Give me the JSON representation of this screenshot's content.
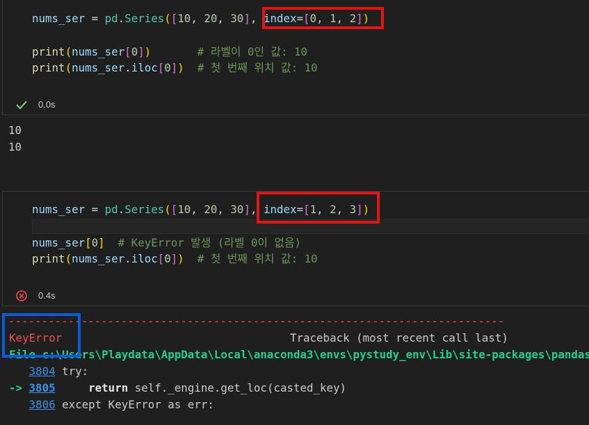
{
  "cell1": {
    "line1": {
      "v": "nums_ser",
      "eq": " = ",
      "m": "pd",
      "dot": ".",
      "cls": "Series",
      "p1": "(",
      "b2": "[",
      "n1": "10",
      "c1": ", ",
      "n2": "20",
      "c2": ", ",
      "n3": "30",
      "b2c": "]",
      "c3": ", ",
      "kw": "index",
      "eq2": "=",
      "b2o": "[",
      "i1": "0",
      "ic1": ", ",
      "i2": "1",
      "ic2": ", ",
      "i3": "2",
      "b2c2": "]",
      "p1c": ")"
    },
    "line2": {
      "f": "print",
      "p": "(",
      "v": "nums_ser",
      "b": "[",
      "n": "0",
      "bc": "]",
      "pc": ")",
      "cmt": "       # 라벨이 0인 값: 10"
    },
    "line3": {
      "f": "print",
      "p": "(",
      "v": "nums_ser",
      "dot": ".",
      "attr": "iloc",
      "b": "[",
      "n": "0",
      "bc": "]",
      "pc": ")",
      "cmt": "  # 첫 번째 위치 값: 10"
    },
    "status_time": "0.0s",
    "status_icon": "check-icon"
  },
  "output1": [
    "10",
    "10"
  ],
  "cell2": {
    "line1": {
      "v": "nums_ser",
      "eq": " = ",
      "m": "pd",
      "dot": ".",
      "cls": "Series",
      "p1": "(",
      "b2": "[",
      "n1": "10",
      "c1": ", ",
      "n2": "20",
      "c2": ", ",
      "n3": "30",
      "b2c": "]",
      "c3": ", ",
      "kw": "index",
      "eq2": "=",
      "b2o": "[",
      "i1": "1",
      "ic1": ", ",
      "i2": "2",
      "ic2": ", ",
      "i3": "3",
      "b2c2": "]",
      "p1c": ")"
    },
    "line3": {
      "v": "nums_ser",
      "b": "[",
      "n": "0",
      "bc": "]",
      "cmt": "  # KeyError 발생 (라벨 0이 없음)"
    },
    "line4": {
      "f": "print",
      "p": "(",
      "v": "nums_ser",
      "dot": ".",
      "attr": "iloc",
      "b": "[",
      "n": "0",
      "bc": "]",
      "pc": ")",
      "cmt": "  # 첫 번째 위치 값: 10"
    },
    "status_time": "0.4s",
    "status_icon": "error-circle-icon"
  },
  "error_output": {
    "dashes": "---------------------------------------------------------------------------",
    "error_name": "KeyError",
    "traceback_label": "Traceback (most recent call last)",
    "file_prefix": "File ",
    "file_path": "c:\\Users\\Playdata\\AppData\\Local\\anaconda3\\envs\\pystudy_env\\Lib\\site-packages\\pandas",
    "lines": [
      {
        "arrow": "   ",
        "num": "3804",
        "code": " try:"
      },
      {
        "arrow": "-> ",
        "num": "3805",
        "code_kw": "     return",
        "code": " self._engine.get_loc(casted_key)"
      },
      {
        "arrow": "   ",
        "num": "3806",
        "code": " except KeyError as err:"
      }
    ]
  },
  "colors": {
    "highlight_red": "#e51414",
    "highlight_blue": "#0b5cd8",
    "error_red": "#f14c4c",
    "link_blue": "#3b8eea",
    "success_green": "#89d185"
  }
}
